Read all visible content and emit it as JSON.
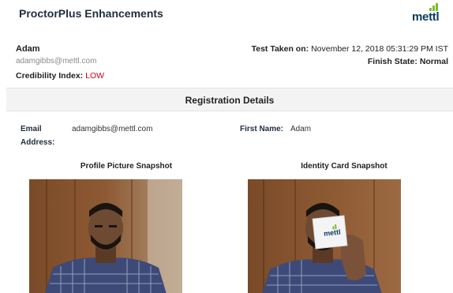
{
  "header": {
    "title": "ProctorPlus Enhancements",
    "logo_text": "mettl"
  },
  "candidate": {
    "name": "Adam",
    "email": "adamgibbs@mettl.com",
    "credibility_label": "Credibility Index:",
    "credibility_value": "LOW"
  },
  "test": {
    "taken_label": "Test Taken on:",
    "taken_value": "November 12, 2018 05:31:29 PM IST",
    "finish_label": "Finish State:",
    "finish_value": "Normal"
  },
  "section": {
    "title": "Registration Details"
  },
  "registration": {
    "email_label_line1": "Email",
    "email_label_line2": "Address:",
    "email_value": "adamgibbs@mettl.com",
    "first_name_label": "First Name:",
    "first_name_value": "Adam"
  },
  "snapshots": {
    "profile_title": "Profile Picture Snapshot",
    "id_card_title": "Identity Card Snapshot",
    "card_logo_text": "mettl"
  },
  "colors": {
    "accent_red": "#d0021b",
    "logo_green": "#7dbb2e",
    "logo_blue": "#0b3a5c"
  }
}
